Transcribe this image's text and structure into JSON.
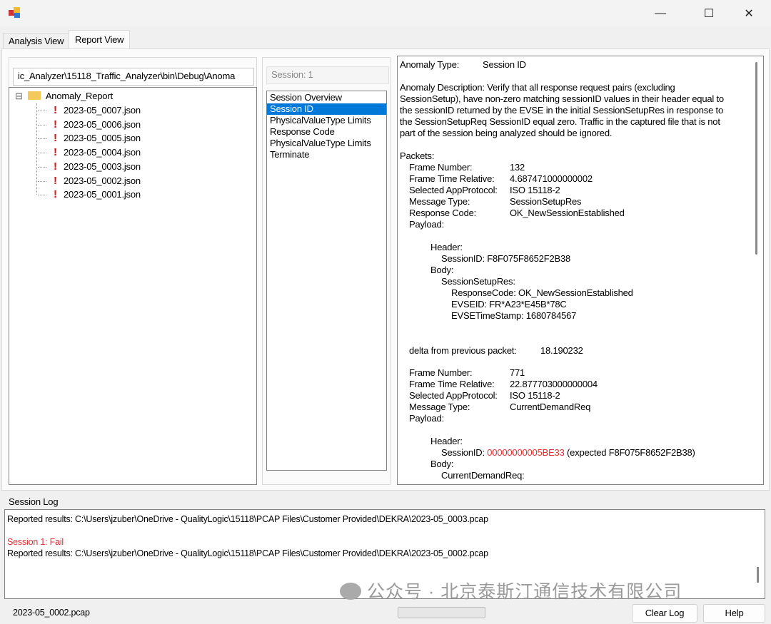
{
  "window": {
    "minimize": "—",
    "maximize": "☐",
    "close": "✕"
  },
  "tabs": [
    {
      "label": "Analysis View"
    },
    {
      "label": "Report View",
      "active": true
    }
  ],
  "left": {
    "path": "ic_Analyzer\\15118_Traffic_Analyzer\\bin\\Debug\\Anoma",
    "root": "Anomaly_Report",
    "expander": "⊟",
    "files": [
      "2023-05_0007.json",
      "2023-05_0006.json",
      "2023-05_0005.json",
      "2023-05_0004.json",
      "2023-05_0003.json",
      "2023-05_0002.json",
      "2023-05_0001.json"
    ],
    "status_mark": "!"
  },
  "middle": {
    "session": "Session: 1",
    "items": [
      "Session Overview",
      "Session ID",
      "PhysicalValueType Limits",
      "Response Code",
      "PhysicalValueType Limits",
      "Terminate"
    ],
    "selected": "Session ID"
  },
  "report": {
    "type_label": "Anomaly Type:",
    "type_value": "Session ID",
    "description": [
      "Anomaly Description: Verify that all response request pairs (excluding",
      "SessionSetup), have non-zero matching sessionID values in their header equal to",
      "the sessionID returned by the EVSE in the initial SessionSetupRes in response to",
      "the SessionSetupReq SessionID equal zero. Traffic in the captured file that is not",
      "part of the session being analyzed should be ignored."
    ],
    "packets_label": "Packets:",
    "p1": {
      "fields": [
        [
          "Frame Number:",
          "132"
        ],
        [
          "Frame Time Relative:",
          "4.687471000000002"
        ],
        [
          "Selected AppProtocol:",
          "ISO 15118-2"
        ],
        [
          "Message Type:",
          "SessionSetupRes"
        ],
        [
          "Response Code:",
          "OK_NewSessionEstablished"
        ]
      ],
      "payload": "Payload:",
      "header": "Header:",
      "session_id": "SessionID: F8F075F8652F2B38",
      "body": "Body:",
      "body_type": "SessionSetupRes:",
      "body_fields": [
        "ResponseCode: OK_NewSessionEstablished",
        "EVSEID: FR*A23*E45B*78C",
        "EVSETimeStamp: 1680784567"
      ]
    },
    "delta_label": "delta from previous packet:",
    "delta_value": "18.190232",
    "p2": {
      "fields": [
        [
          "Frame Number:",
          "771"
        ],
        [
          "Frame Time Relative:",
          "22.877703000000004"
        ],
        [
          "Selected AppProtocol:",
          "ISO 15118-2"
        ],
        [
          "Message Type:",
          "CurrentDemandReq"
        ]
      ],
      "payload": "Payload:",
      "header": "Header:",
      "session_id_label": "SessionID: ",
      "session_id_value": "00000000005BE33",
      "session_id_expected": " (expected F8F075F8652F2B38)",
      "body": "Body:",
      "body_type": "CurrentDemandReq:"
    }
  },
  "log": {
    "title": "Session Log",
    "lines": [
      "Reported results: C:\\Users\\jzuber\\OneDrive - QualityLogic\\15118\\PCAP Files\\Customer Provided\\DEKRA\\2023-05_0003.pcap",
      "",
      "Session 1: Fail",
      "Reported results: C:\\Users\\jzuber\\OneDrive - QualityLogic\\15118\\PCAP Files\\Customer Provided\\DEKRA\\2023-05_0002.pcap"
    ]
  },
  "status": {
    "file": "2023-05_0002.pcap",
    "progress": 0,
    "clear_log": "Clear Log",
    "help": "Help"
  },
  "watermark": "公众号 · 北京泰斯汀通信技术有限公司",
  "colors": {
    "selection": "#0078d7",
    "error": "#d33333"
  }
}
